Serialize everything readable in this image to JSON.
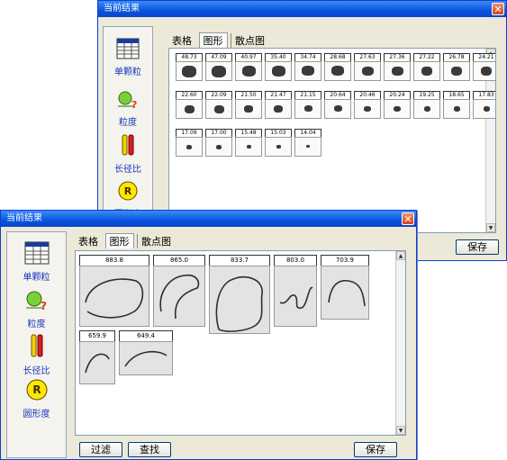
{
  "back_window": {
    "title": "当前结果",
    "tools": [
      {
        "label": "单颗粒",
        "icon": "table-grid-icon"
      },
      {
        "label": "粒度",
        "icon": "particle-size-icon"
      },
      {
        "label": "长径比",
        "icon": "aspect-ratio-icon"
      },
      {
        "label": "圆形度",
        "icon": "roundness-r-icon"
      }
    ],
    "tabs": [
      "表格",
      "图形",
      "散点图"
    ],
    "active_tab": "图形",
    "thumbnails": [
      "48.73",
      "47.09",
      "40.97",
      "35.40",
      "34.74",
      "28.68",
      "27.63",
      "27.36",
      "27.22",
      "26.78",
      "24.21",
      "22.60",
      "22.09",
      "21.50",
      "21.47",
      "21.15",
      "20.64",
      "20.46",
      "20.24",
      "19.25",
      "18.65",
      "17.83",
      "17.09",
      "17.00",
      "15.48",
      "15.03",
      "14.04"
    ],
    "save_label": "保存"
  },
  "front_window": {
    "title": "当前结果",
    "tools": [
      {
        "label": "单颗粒",
        "icon": "table-grid-icon"
      },
      {
        "label": "粒度",
        "icon": "particle-size-icon"
      },
      {
        "label": "长径比",
        "icon": "aspect-ratio-icon"
      },
      {
        "label": "圆形度",
        "icon": "roundness-r-icon"
      }
    ],
    "tabs": [
      "表格",
      "图形",
      "散点图"
    ],
    "active_tab": "图形",
    "thumbnails": [
      "883.8",
      "865.0",
      "833.7",
      "803.0",
      "703.9",
      "659.9",
      "649.4"
    ],
    "filter_label": "过滤",
    "find_label": "查找",
    "save_label": "保存"
  },
  "colors": {
    "titlebar": "#0a54e0",
    "window_bg": "#ece9d8",
    "link_blue": "#1636b8",
    "close_red": "#d8431f"
  }
}
